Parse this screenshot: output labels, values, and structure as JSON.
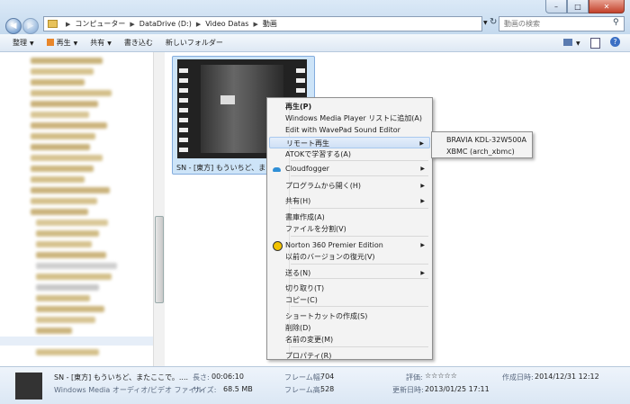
{
  "window": {
    "minimize": "–",
    "maximize": "□",
    "close": "✕"
  },
  "address": {
    "crumbs": [
      "コンピューター",
      "DataDrive (D:)",
      "Video Datas",
      "動画"
    ],
    "search_placeholder": "動画の検索"
  },
  "toolbar": {
    "organize": "整理",
    "play": "再生",
    "share": "共有",
    "burn": "書き込む",
    "new_folder": "新しいフォルダー"
  },
  "file": {
    "caption": "SN - [東方] もういちど、また"
  },
  "status": {
    "title": "SN - [東方] もういちど、またここで。....",
    "type": "Windows Media オーディオ/ビデオ ファイル",
    "length_label": "長さ:",
    "length": "00:06:10",
    "size_label": "サイズ:",
    "size": "68.5 MB",
    "frame_width_label": "フレーム幅:",
    "frame_width": "704",
    "frame_height_label": "フレーム高:",
    "frame_height": "528",
    "rating_label": "評価:",
    "rating_stars": "☆☆☆☆☆",
    "rating_value": 0,
    "updated_label": "更新日時:",
    "updated": "2013/01/25 17:11",
    "created_label": "作成日時:",
    "created": "2014/12/31 12:12"
  },
  "context_menu": {
    "items": [
      {
        "label": "再生(P)",
        "bold": true
      },
      {
        "label": "Windows Media Player リストに追加(A)"
      },
      {
        "label": "Edit with WavePad Sound Editor"
      },
      {
        "label": "リモート再生",
        "submenu": true,
        "highlighted": true
      },
      {
        "label": "ATOKで学習する(A)"
      },
      {
        "label": "Cloudfogger",
        "submenu": true,
        "icon": "cloud-icon"
      },
      {
        "label": "プログラムから開く(H)",
        "submenu": true
      },
      {
        "label": "共有(H)",
        "submenu": true
      },
      {
        "label": "書庫作成(A)"
      },
      {
        "label": "ファイルを分割(V)"
      },
      {
        "label": "Norton 360 Premier Edition",
        "submenu": true,
        "icon": "norton-icon"
      },
      {
        "label": "以前のバージョンの復元(V)"
      },
      {
        "label": "送る(N)",
        "submenu": true
      },
      {
        "label": "切り取り(T)"
      },
      {
        "label": "コピー(C)"
      },
      {
        "label": "ショートカットの作成(S)"
      },
      {
        "label": "削除(D)"
      },
      {
        "label": "名前の変更(M)"
      },
      {
        "label": "プロパティ(R)"
      }
    ]
  },
  "submenu": {
    "items": [
      {
        "label": "BRAVIA KDL-32W500A"
      },
      {
        "label": "XBMC (arch_xbmc)"
      }
    ]
  },
  "colors": {
    "highlight_bg": "#cfe0f5",
    "highlight_border": "#a8c8ee",
    "norton": "#f2c200",
    "cloud": "#2f8fd6"
  }
}
